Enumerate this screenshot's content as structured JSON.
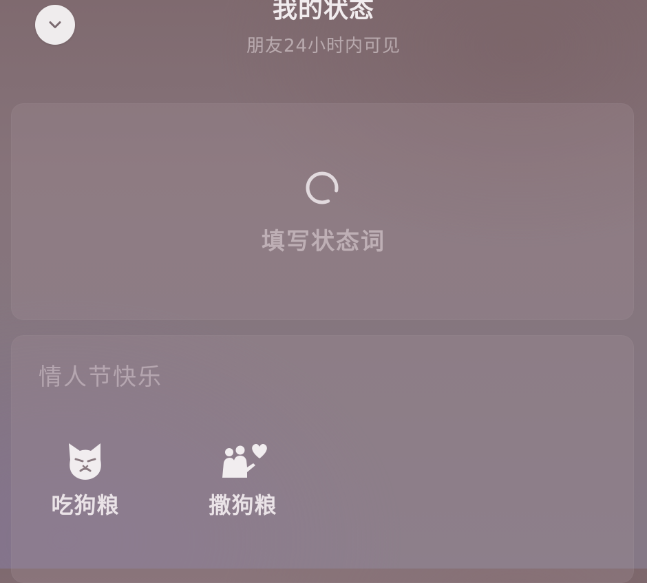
{
  "header": {
    "title": "我的状态",
    "subtitle": "朋友24小时内可见",
    "collapse_icon": "chevron-down-icon"
  },
  "input_card": {
    "placeholder": "填写状态词",
    "icon": "loading-spinner-icon"
  },
  "status_group": {
    "title": "情人节快乐",
    "options": [
      {
        "label": "吃狗粮",
        "icon": "grumpy-cat-face-icon"
      },
      {
        "label": "撒狗粮",
        "icon": "couple-with-heart-icon"
      }
    ]
  },
  "colors": {
    "background_top": "#7f6a6f",
    "background_bottom": "#857886",
    "card_fill": "rgba(165,148,156,0.26)",
    "button_fill": "#efeced",
    "text_primary": "#f1ecee"
  }
}
